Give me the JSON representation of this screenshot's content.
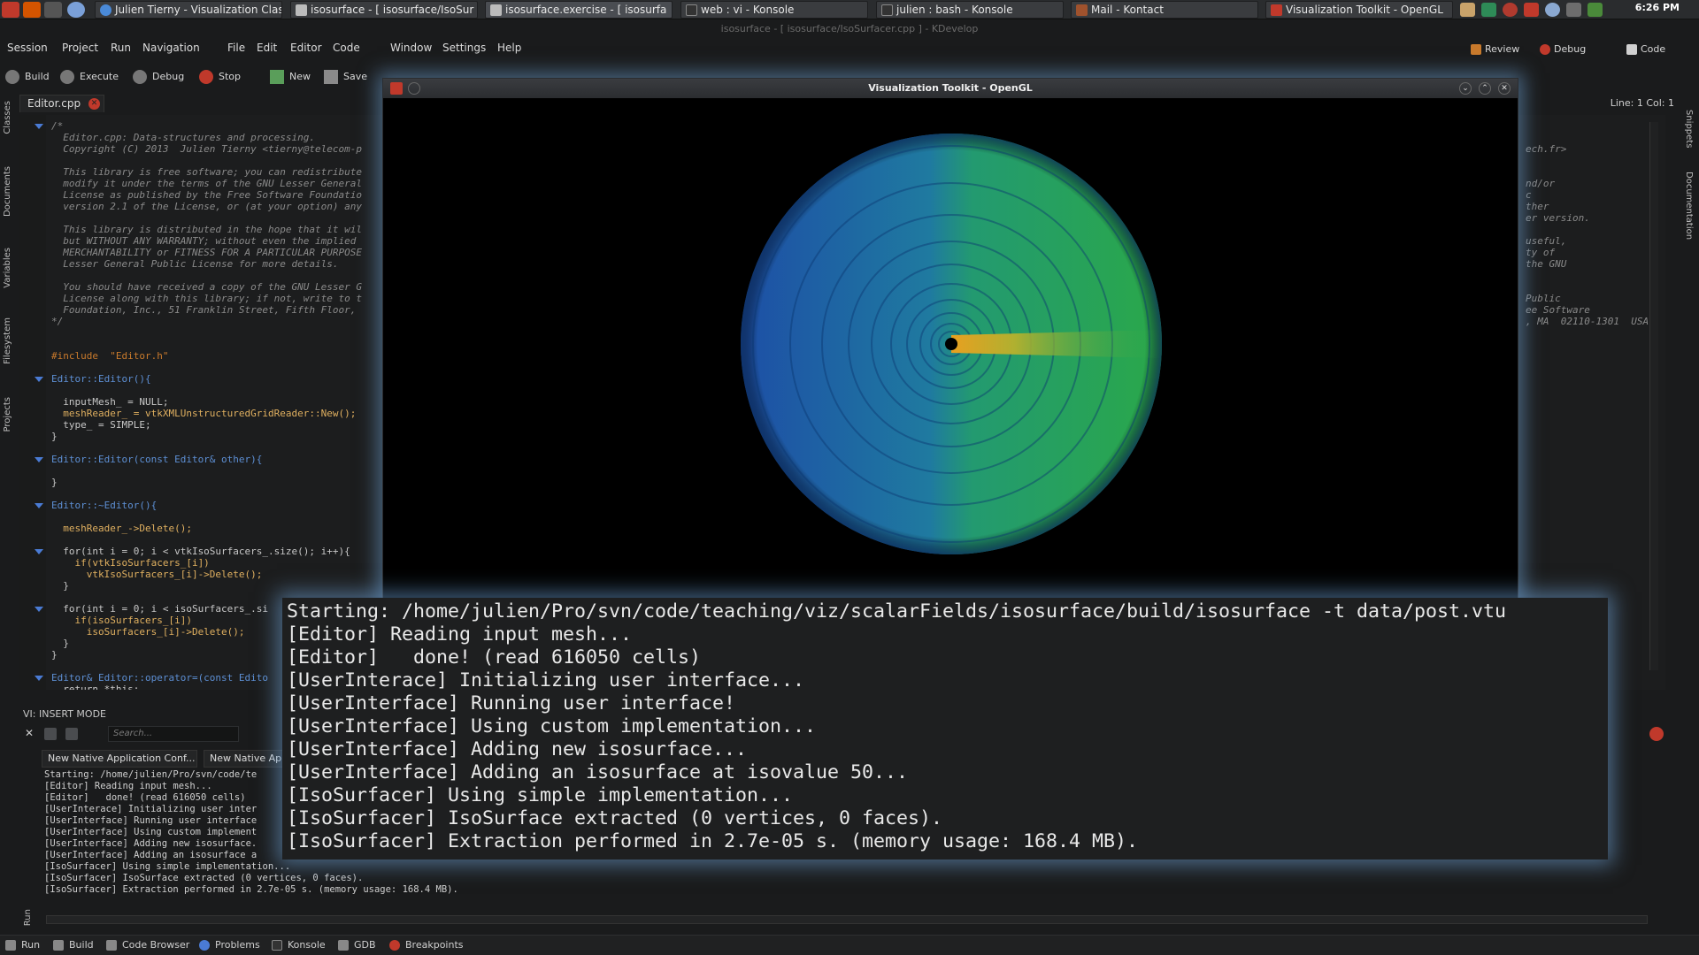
{
  "taskbar": {
    "tasks": [
      {
        "label": "Julien Tierny - Visualization Clas",
        "icon": "browser-icon"
      },
      {
        "label": "isosurface - [ isosurface/IsoSur",
        "icon": "kdevelop-icon"
      },
      {
        "label": "isosurface.exercise - [ isosurfa",
        "icon": "kdevelop-icon"
      },
      {
        "label": "web : vi - Konsole",
        "icon": "terminal-icon"
      },
      {
        "label": "julien : bash - Konsole",
        "icon": "terminal-icon"
      },
      {
        "label": "Mail - Kontact",
        "icon": "mail-icon"
      },
      {
        "label": "Visualization Toolkit - OpenGL",
        "icon": "vtk-icon"
      }
    ],
    "clock": "6:26 PM"
  },
  "window_title": "isosurface - [ isosurface/IsoSurfacer.cpp ] - KDevelop",
  "menu": [
    "Session",
    "Project",
    "Run",
    "Navigation",
    "File",
    "Edit",
    "Editor",
    "Code",
    "Window",
    "Settings",
    "Help"
  ],
  "areas": {
    "review": "Review",
    "debug": "Debug",
    "code": "Code"
  },
  "toolbar": {
    "build": "Build",
    "execute": "Execute",
    "debug": "Debug",
    "stop": "Stop",
    "new": "New",
    "save": "Save"
  },
  "left_dock": [
    "Classes",
    "Documents",
    "Variables",
    "Filesystem",
    "Projects"
  ],
  "right_dock": [
    "Snippets",
    "Documentation"
  ],
  "doc_tab": "Editor.cpp",
  "cursor": "Line: 1 Col: 1",
  "code_lines": [
    "/*",
    "  Editor.cpp: Data-structures and processing.",
    "  Copyright (C) 2013  Julien Tierny <tierny@telecom-p",
    "",
    "  This library is free software; you can redistribute",
    "  modify it under the terms of the GNU Lesser General",
    "  License as published by the Free Software Foundatio",
    "  version 2.1 of the License, or (at your option) any",
    "",
    "  This library is distributed in the hope that it wil",
    "  but WITHOUT ANY WARRANTY; without even the implied",
    "  MERCHANTABILITY or FITNESS FOR A PARTICULAR PURPOSE",
    "  Lesser General Public License for more details.",
    "",
    "  You should have received a copy of the GNU Lesser G",
    "  License along with this library; if not, write to t",
    "  Foundation, Inc., 51 Franklin Street, Fifth Floor,",
    "*/",
    "",
    "",
    "#include  \"Editor.h\"",
    "",
    "Editor::Editor(){",
    "",
    "  inputMesh_ = NULL;",
    "  meshReader_ = vtkXMLUnstructuredGridReader::New();",
    "  type_ = SIMPLE;",
    "}",
    "",
    "Editor::Editor(const Editor& other){",
    "",
    "}",
    "",
    "Editor::~Editor(){",
    "",
    "  meshReader_->Delete();",
    "",
    "  for(int i = 0; i < vtkIsoSurfacers_.size(); i++){",
    "    if(vtkIsoSurfacers_[i])",
    "      vtkIsoSurfacers_[i]->Delete();",
    "  }",
    "",
    "  for(int i = 0; i < isoSurfacers_.si",
    "    if(isoSurfacers_[i])",
    "      isoSurfacers_[i]->Delete();",
    "  }",
    "}",
    "",
    "Editor& Editor::operator=(const Edito",
    "  return *this;"
  ],
  "code_right": [
    "",
    "",
    "ech.fr>",
    "",
    "",
    "nd/or",
    "c",
    "ther",
    "er version.",
    "",
    "useful,",
    "ty of",
    "the GNU",
    "",
    "",
    "Public",
    "ee Software",
    ", MA  02110-1301  USA"
  ],
  "vi_mode": "VI: INSERT MODE",
  "search_placeholder": "Search...",
  "output_tabs": [
    "New Native Application Conf...",
    "New Native Ap"
  ],
  "output_lines": [
    "Starting: /home/julien/Pro/svn/code/te",
    "[Editor] Reading input mesh...",
    "[Editor]   done! (read 616050 cells)",
    "[UserInterace] Initializing user inter",
    "[UserInterface] Running user interface",
    "[UserInterface] Using custom implement",
    "[UserInterface] Adding new isosurface.",
    "[UserInterface] Adding an isosurface a",
    "[IsoSurfacer] Using simple implementation...",
    "[IsoSurfacer] IsoSurface extracted (0 vertices, 0 faces).",
    "[IsoSurfacer] Extraction performed in 2.7e-05 s. (memory usage: 168.4 MB)."
  ],
  "run_label": "Run",
  "bottom_tools": [
    "Run",
    "Build",
    "Code Browser",
    "Problems",
    "Konsole",
    "GDB",
    "Breakpoints"
  ],
  "vtk_window": {
    "title": "Visualization Toolkit - OpenGL"
  },
  "konsole_lines": [
    "Starting: /home/julien/Pro/svn/code/teaching/viz/scalarFields/isosurface/build/isosurface -t data/post.vtu",
    "[Editor] Reading input mesh...",
    "[Editor]   done! (read 616050 cells)",
    "[UserInterace] Initializing user interface...",
    "[UserInterface] Running user interface!",
    "[UserInterface] Using custom implementation...",
    "[UserInterface] Adding new isosurface...",
    "[UserInterface] Adding an isosurface at isovalue 50...",
    "[IsoSurfacer] Using simple implementation...",
    "[IsoSurfacer] IsoSurface extracted (0 vertices, 0 faces).",
    "[IsoSurfacer] Extraction performed in 2.7e-05 s. (memory usage: 168.4 MB)."
  ],
  "colors": {
    "accent": "#4a7bd4",
    "glow": "#6ea0d2",
    "disc_blue": "#1a5aa8",
    "disc_green": "#2aa84a",
    "hot": "#e0a020"
  }
}
